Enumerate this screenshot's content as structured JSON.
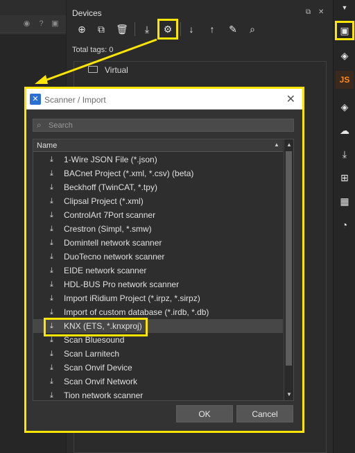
{
  "devices_panel": {
    "title": "Devices",
    "total_tags": "Total tags: 0",
    "tree_items": [
      {
        "label": "Virtual"
      }
    ]
  },
  "right_bar": {
    "js_label": "JS"
  },
  "dialog": {
    "title": "Scanner / Import",
    "search_placeholder": "Search",
    "column_header": "Name",
    "items": [
      "1-Wire JSON File (*.json)",
      "BACnet Project (*.xml, *.csv) (beta)",
      "Beckhoff (TwinCAT, *.tpy)",
      "Clipsal Project (*.xml)",
      "ControlArt 7Port scanner",
      "Crestron (Simpl, *.smw)",
      "Domintell network scanner",
      "DuoTecno network scanner",
      "EIDE network scanner",
      "HDL-BUS Pro network scanner",
      "Import iRidium Project (*.irpz, *.sirpz)",
      "Import of custom database (*.irdb, *.db)",
      "KNX (ETS, *.knxproj)",
      "Scan Bluesound",
      "Scan Larnitech",
      "Scan Onvif Device",
      "Scan Onvif Network",
      "Tion network scanner"
    ],
    "selected_item": "KNX (ETS, *.knxproj)",
    "ok_label": "OK",
    "cancel_label": "Cancel"
  },
  "colors": {
    "highlight": "#ffe600",
    "accent_js": "#ff8a1e",
    "dialog_icon": "#2a6fd6"
  }
}
